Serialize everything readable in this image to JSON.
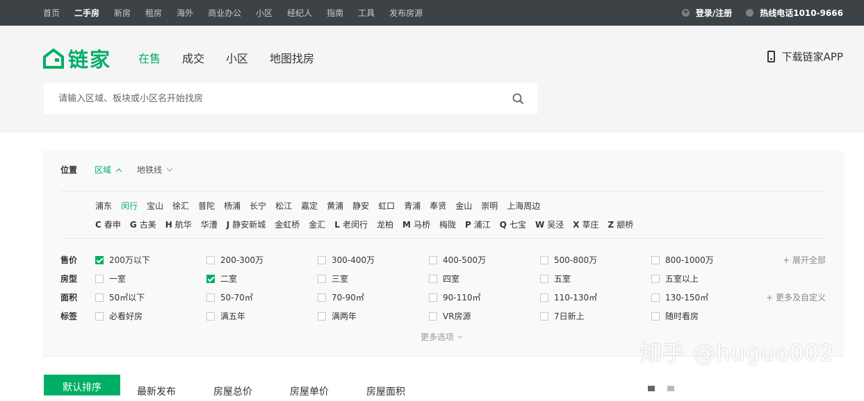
{
  "topnav": [
    "首页",
    "二手房",
    "新房",
    "租房",
    "海外",
    "商业办公",
    "小区",
    "经纪人",
    "指南",
    "工具",
    "发布房源"
  ],
  "topnav_active_index": 1,
  "topright": {
    "login": "登录/注册",
    "hotline": "热线电话1010-9666"
  },
  "logo_text": "链家",
  "brand_color": "#00ae66",
  "mainnav": [
    "在售",
    "成交",
    "小区",
    "地图找房"
  ],
  "app_download": "下载链家APP",
  "search": {
    "placeholder": "请输入区域、板块或小区名开始找房"
  },
  "location": {
    "label": "位置",
    "tab_district": "区域",
    "tab_subway": "地铁线"
  },
  "districts": [
    "浦东",
    "闵行",
    "宝山",
    "徐汇",
    "普陀",
    "杨浦",
    "长宁",
    "松江",
    "嘉定",
    "黄浦",
    "静安",
    "虹口",
    "青浦",
    "奉贤",
    "金山",
    "崇明",
    "上海周边"
  ],
  "district_active": "闵行",
  "subdistricts": [
    {
      "letter": "C",
      "name": "春申"
    },
    {
      "letter": "G",
      "name": "古美"
    },
    {
      "letter": "H",
      "name": "航华"
    },
    {
      "letter": "",
      "name": "华漕"
    },
    {
      "letter": "J",
      "name": "静安新城"
    },
    {
      "letter": "",
      "name": "金虹桥"
    },
    {
      "letter": "",
      "name": "金汇"
    },
    {
      "letter": "L",
      "name": "老闵行"
    },
    {
      "letter": "",
      "name": "龙柏"
    },
    {
      "letter": "M",
      "name": "马桥"
    },
    {
      "letter": "",
      "name": "梅陇"
    },
    {
      "letter": "P",
      "name": "浦江"
    },
    {
      "letter": "Q",
      "name": "七宝"
    },
    {
      "letter": "W",
      "name": "吴泾"
    },
    {
      "letter": "X",
      "name": "莘庄"
    },
    {
      "letter": "Z",
      "name": "颛桥"
    }
  ],
  "filters": {
    "price": {
      "label": "售价",
      "options": [
        "200万以下",
        "200-300万",
        "300-400万",
        "400-500万",
        "500-800万",
        "800-1000万"
      ],
      "checked": [
        true,
        false,
        false,
        false,
        false,
        false
      ],
      "more": "+ 展开全部"
    },
    "layout": {
      "label": "房型",
      "options": [
        "一室",
        "二室",
        "三室",
        "四室",
        "五室",
        "五室以上"
      ],
      "checked": [
        false,
        true,
        false,
        false,
        false,
        false
      ]
    },
    "area": {
      "label": "面积",
      "options": [
        "50㎡以下",
        "50-70㎡",
        "70-90㎡",
        "90-110㎡",
        "110-130㎡",
        "130-150㎡"
      ],
      "checked": [
        false,
        false,
        false,
        false,
        false,
        false
      ],
      "more": "+ 更多及自定义"
    },
    "tags": {
      "label": "标签",
      "options": [
        "必看好房",
        "满五年",
        "满两年",
        "VR房源",
        "7日新上",
        "随时看房"
      ],
      "checked": [
        false,
        false,
        false,
        false,
        false,
        false
      ]
    }
  },
  "more_options": "更多选项",
  "sort": {
    "default": "默认排序",
    "items": [
      "最新发布",
      "房屋总价",
      "房屋单价",
      "房屋面积"
    ]
  },
  "watermark": "知乎 @huguo002"
}
